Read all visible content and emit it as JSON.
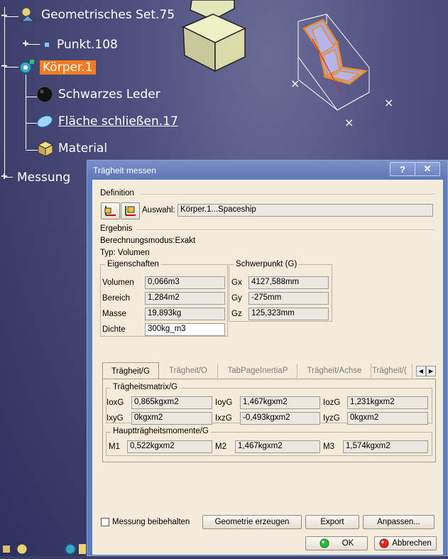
{
  "tree": {
    "items": [
      {
        "label": "Geometrisches Set.75"
      },
      {
        "label": "Punkt.108"
      },
      {
        "label": "Körper.1"
      },
      {
        "label": "Schwarzes Leder"
      },
      {
        "label": "Fläche schließen.17"
      },
      {
        "label": "Material"
      },
      {
        "label": "Messung"
      }
    ]
  },
  "dialog": {
    "title": "Trägheit messen",
    "help_label": "?",
    "close_label": "✕",
    "definition": {
      "heading": "Definition",
      "selection_label": "Auswahl:",
      "selection_value": "Körper.1...Spaceship"
    },
    "result": {
      "heading": "Ergebnis",
      "calc_mode": "Berechnungsmodus:Exakt",
      "type": "Typ: Volumen"
    },
    "properties": {
      "heading": "Eigenschaften",
      "rows": [
        {
          "label": "Volumen",
          "value": "0,066m3"
        },
        {
          "label": "Bereich",
          "value": "1,284m2"
        },
        {
          "label": "Masse",
          "value": "19,893kg"
        },
        {
          "label": "Dichte",
          "value": "300kg_m3"
        }
      ]
    },
    "cog": {
      "heading": "Schwerpunkt (G)",
      "rows": [
        {
          "label": "Gx",
          "value": "4127,588mm"
        },
        {
          "label": "Gy",
          "value": "-275mm"
        },
        {
          "label": "Gz",
          "value": "125,323mm"
        }
      ]
    },
    "tabs": [
      {
        "label": "Trägheit/G",
        "active": true
      },
      {
        "label": "Trägheit/O",
        "active": false
      },
      {
        "label": "TabPageInertiaP",
        "active": false
      },
      {
        "label": "Trägheit/Achse",
        "active": false
      },
      {
        "label": "Trägheit/(",
        "active": false
      }
    ],
    "inertia_matrix": {
      "heading": "Trägheitsmatrix/G",
      "row1": [
        {
          "label": "IoxG",
          "value": "0,865kgxm2"
        },
        {
          "label": "IoyG",
          "value": "1,467kgxm2"
        },
        {
          "label": "IozG",
          "value": "1,231kgxm2"
        }
      ],
      "row2": [
        {
          "label": "IxyG",
          "value": "0kgxm2"
        },
        {
          "label": "IxzG",
          "value": "-0,493kgxm2"
        },
        {
          "label": "IyzG",
          "value": "0kgxm2"
        }
      ]
    },
    "principal_moments": {
      "heading": "Hauptträgheitsmomente/G",
      "row": [
        {
          "label": "M1",
          "value": "0,522kgxm2"
        },
        {
          "label": "M2",
          "value": "1,467kgxm2"
        },
        {
          "label": "M3",
          "value": "1,574kgxm2"
        }
      ]
    },
    "footer": {
      "keep_label": "Messung beibehalten",
      "geometry_button": "Geometrie erzeugen",
      "export_button": "Export",
      "customize_button": "Anpassen...",
      "ok_button": "OK",
      "cancel_button": "Abbrechen"
    }
  },
  "colors": {
    "highlight": "#f47b20",
    "dialog_bg": "#f5ebd9",
    "titlebar": "#6a82c3"
  }
}
